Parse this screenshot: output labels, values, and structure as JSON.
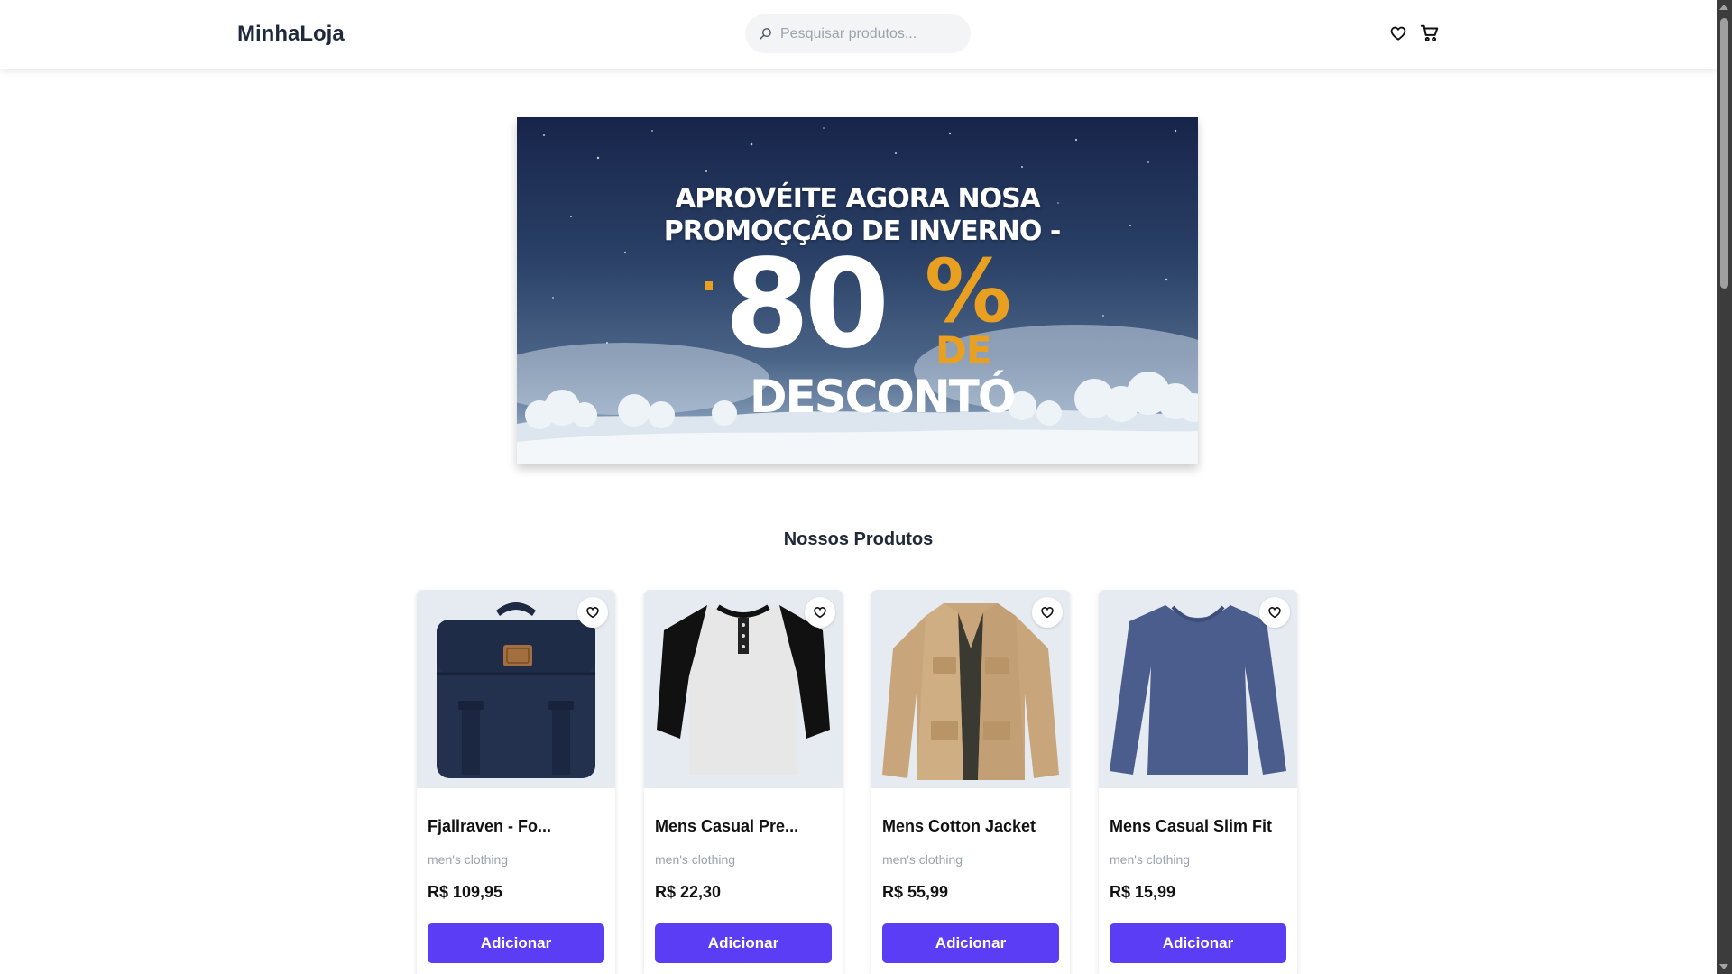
{
  "header": {
    "logo": "MinhaLoja",
    "search_placeholder": "Pesquisar produtos...",
    "icons": [
      "search-icon",
      "heart-icon",
      "cart-icon"
    ]
  },
  "banner": {
    "line1": "APROVÉITE AGORA NOSA",
    "line2": "PROMOÇÇÃO DE INVERNO -",
    "discount": "80",
    "percent": "%",
    "de": "DE",
    "desconto": "DESCONTÓ"
  },
  "section": {
    "title": "Nossos Produtos"
  },
  "products": [
    {
      "title": "Fjallraven - Fo...",
      "category": "men's clothing",
      "price": "R$ 109,95",
      "button": "Adicionar",
      "image": "backpack"
    },
    {
      "title": "Mens Casual Pre...",
      "category": "men's clothing",
      "price": "R$ 22,30",
      "button": "Adicionar",
      "image": "raglan-tshirt"
    },
    {
      "title": "Mens Cotton Jacket",
      "category": "men's clothing",
      "price": "R$ 55,99",
      "button": "Adicionar",
      "image": "jacket"
    },
    {
      "title": "Mens Casual Slim Fit",
      "category": "men's clothing",
      "price": "R$ 15,99",
      "button": "Adicionar",
      "image": "longsleeve"
    }
  ],
  "colors": {
    "accent": "#5b3df5",
    "banner_gold": "#e9a020",
    "card_image_bg": "#e6ebf2"
  }
}
